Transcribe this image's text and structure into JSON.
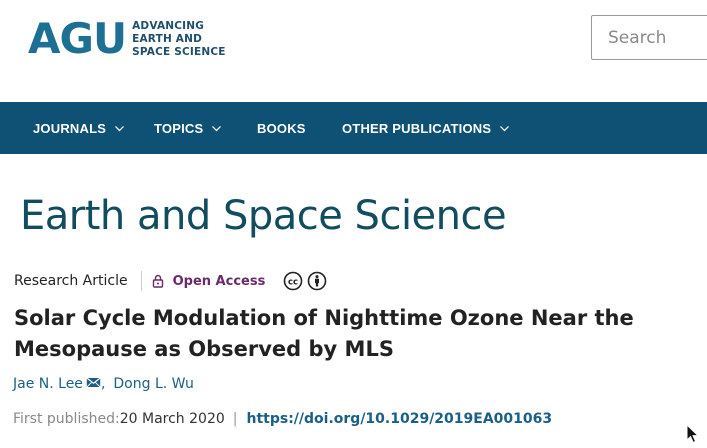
{
  "header": {
    "logo_mark": "AGU",
    "logo_tagline": [
      "ADVANCING",
      "EARTH AND",
      "SPACE SCIENCE"
    ],
    "search_placeholder": "Search"
  },
  "nav": {
    "items": [
      {
        "label": "JOURNALS",
        "has_dropdown": true
      },
      {
        "label": "TOPICS",
        "has_dropdown": true
      },
      {
        "label": "BOOKS",
        "has_dropdown": false
      },
      {
        "label": "OTHER PUBLICATIONS",
        "has_dropdown": true
      }
    ]
  },
  "journal": {
    "title": "Earth and Space Science"
  },
  "article": {
    "type": "Research Article",
    "access": "Open Access",
    "license_icons": [
      "creative-commons-icon",
      "attribution-icon"
    ],
    "title": "Solar Cycle Modulation of Nighttime Ozone Near the Mesopause as Observed by MLS",
    "authors": [
      {
        "name": "Jae N. Lee",
        "corresponding": true
      },
      {
        "name": "Dong L. Wu",
        "corresponding": false
      }
    ],
    "author_separator": ",",
    "published_label": "First published:",
    "published_date": "20 March 2020",
    "pipe": "|",
    "doi": "https://doi.org/10.1029/2019EA001063"
  },
  "colors": {
    "nav_bg": "#0e5174",
    "logo_blue": "#1d6f93",
    "journal_title": "#114d5e",
    "link": "#1b5f86",
    "open_access": "#6b2a6b"
  }
}
